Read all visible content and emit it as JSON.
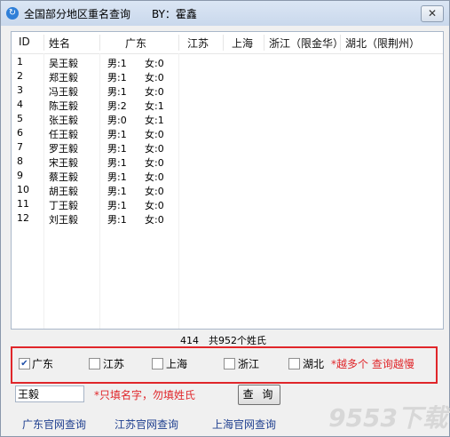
{
  "window": {
    "title": "全国部分地区重名查询　　BY：霍鑫",
    "icon": "app-logo",
    "close_glyph": "✕"
  },
  "table": {
    "headers": [
      "ID",
      "姓名",
      "广东",
      "江苏",
      "上海",
      "浙江（限金华）",
      "湖北（限荆州）"
    ],
    "rows": [
      {
        "id": "1",
        "name": "吴王毅",
        "male": "男:1",
        "female": "女:0"
      },
      {
        "id": "2",
        "name": "郑王毅",
        "male": "男:1",
        "female": "女:0"
      },
      {
        "id": "3",
        "name": "冯王毅",
        "male": "男:1",
        "female": "女:0"
      },
      {
        "id": "4",
        "name": "陈王毅",
        "male": "男:2",
        "female": "女:1"
      },
      {
        "id": "5",
        "name": "张王毅",
        "male": "男:0",
        "female": "女:1"
      },
      {
        "id": "6",
        "name": "任王毅",
        "male": "男:1",
        "female": "女:0"
      },
      {
        "id": "7",
        "name": "罗王毅",
        "male": "男:1",
        "female": "女:0"
      },
      {
        "id": "8",
        "name": "宋王毅",
        "male": "男:1",
        "female": "女:0"
      },
      {
        "id": "9",
        "name": "蔡王毅",
        "male": "男:1",
        "female": "女:0"
      },
      {
        "id": "10",
        "name": "胡王毅",
        "male": "男:1",
        "female": "女:0"
      },
      {
        "id": "11",
        "name": "丁王毅",
        "male": "男:1",
        "female": "女:0"
      },
      {
        "id": "12",
        "name": "刘王毅",
        "male": "男:1",
        "female": "女:0"
      }
    ]
  },
  "summary": "414　共952个姓氏",
  "regions": {
    "items": [
      {
        "label": "广东",
        "checked": true
      },
      {
        "label": "江苏",
        "checked": false
      },
      {
        "label": "上海",
        "checked": false
      },
      {
        "label": "浙江",
        "checked": false
      },
      {
        "label": "湖北",
        "checked": false
      }
    ],
    "hint": "*越多个 查询越慢",
    "check_glyph": "✔"
  },
  "search": {
    "value": "王毅",
    "note": "*只填名字，勿填姓氏",
    "button": "查 询"
  },
  "links": [
    "广东官网查询",
    "江苏官网查询",
    "上海官网查询"
  ],
  "watermark": "9553下载",
  "colors": {
    "accent_red": "#e0262a",
    "link_blue": "#1f3f8f"
  }
}
